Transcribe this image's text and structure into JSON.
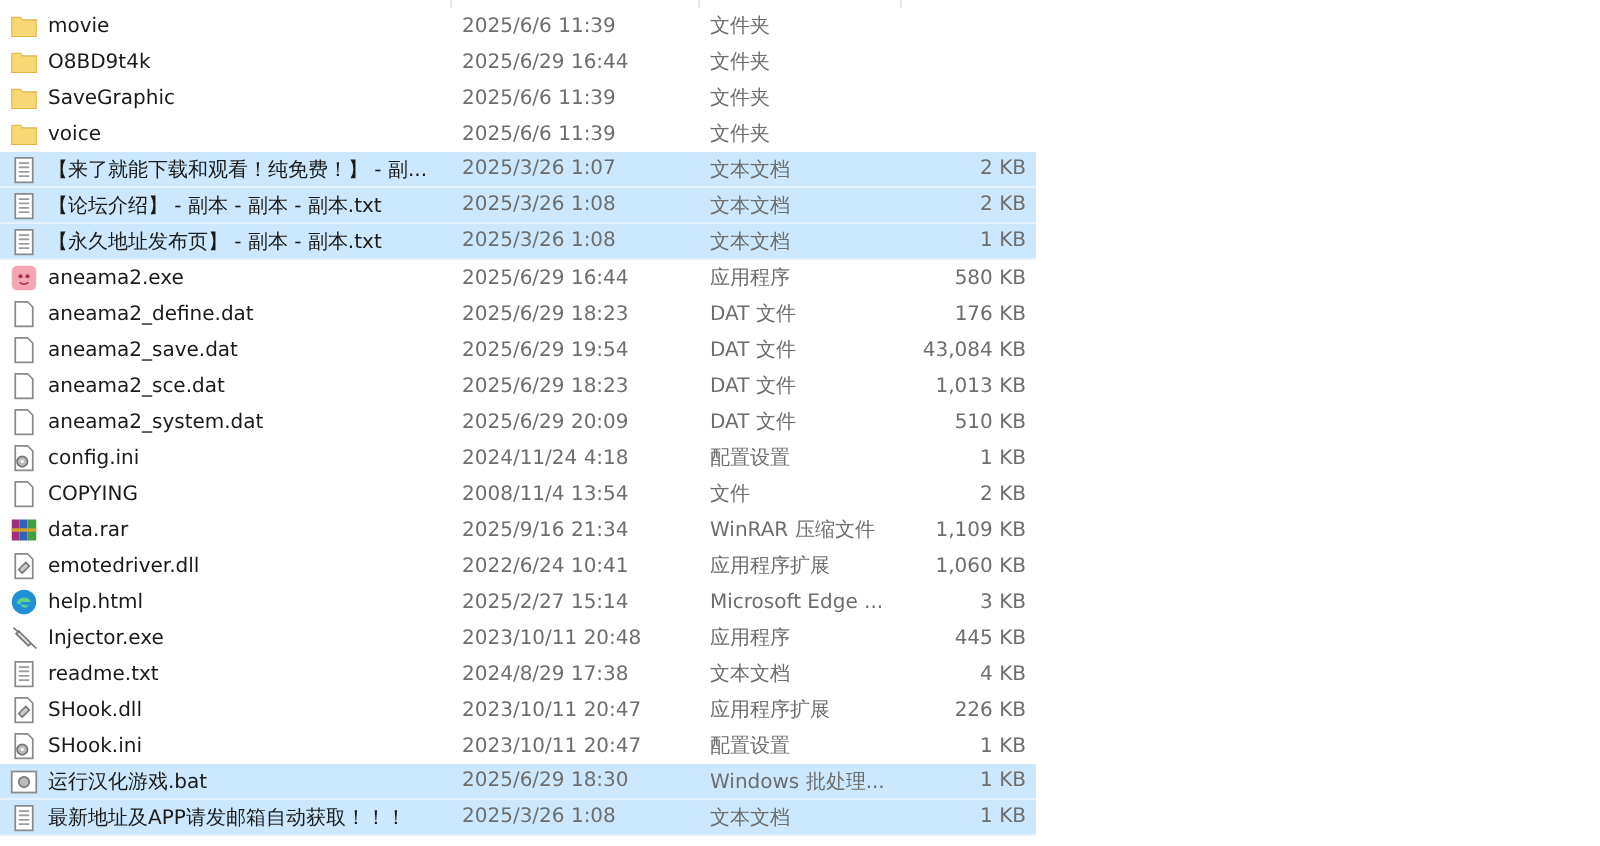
{
  "files": [
    {
      "kind": "folder",
      "name": "movie",
      "modified": "2025/6/6 11:39",
      "type": "文件夹",
      "selected": false
    },
    {
      "kind": "folder",
      "name": "O8BD9t4k",
      "modified": "2025/6/29 16:44",
      "type": "文件夹",
      "selected": false
    },
    {
      "kind": "folder",
      "name": "SaveGraphic",
      "modified": "2025/6/6 11:39",
      "type": "文件夹",
      "selected": false
    },
    {
      "kind": "folder",
      "name": "voice",
      "modified": "2025/6/6 11:39",
      "type": "文件夹",
      "selected": false
    },
    {
      "kind": "text",
      "name": "【来了就能下载和观看！纯免费！】 - 副...",
      "modified": "2025/3/26 1:07",
      "type": "文本文档",
      "size": "2 KB",
      "selected": true
    },
    {
      "kind": "text",
      "name": "【论坛介绍】 - 副本 - 副本 - 副本.txt",
      "modified": "2025/3/26 1:08",
      "type": "文本文档",
      "size": "2 KB",
      "selected": true
    },
    {
      "kind": "text",
      "name": "【永久地址发布页】 - 副本 - 副本.txt",
      "modified": "2025/3/26 1:08",
      "type": "文本文档",
      "size": "1 KB",
      "selected": true
    },
    {
      "kind": "app",
      "name": "aneama2.exe",
      "modified": "2025/6/29 16:44",
      "type": "应用程序",
      "size": "580 KB",
      "selected": false
    },
    {
      "kind": "blank",
      "name": "aneama2_define.dat",
      "modified": "2025/6/29 18:23",
      "type": "DAT 文件",
      "size": "176 KB",
      "selected": false
    },
    {
      "kind": "blank",
      "name": "aneama2_save.dat",
      "modified": "2025/6/29 19:54",
      "type": "DAT 文件",
      "size": "43,084 KB",
      "selected": false
    },
    {
      "kind": "blank",
      "name": "aneama2_sce.dat",
      "modified": "2025/6/29 18:23",
      "type": "DAT 文件",
      "size": "1,013 KB",
      "selected": false
    },
    {
      "kind": "blank",
      "name": "aneama2_system.dat",
      "modified": "2025/6/29 20:09",
      "type": "DAT 文件",
      "size": "510 KB",
      "selected": false
    },
    {
      "kind": "config",
      "name": "config.ini",
      "modified": "2024/11/24 4:18",
      "type": "配置设置",
      "size": "1 KB",
      "selected": false
    },
    {
      "kind": "blank",
      "name": "COPYING",
      "modified": "2008/11/4 13:54",
      "type": "文件",
      "size": "2 KB",
      "selected": false
    },
    {
      "kind": "archive",
      "name": "data.rar",
      "modified": "2025/9/16 21:34",
      "type": "WinRAR 压缩文件",
      "size": "1,109 KB",
      "selected": false
    },
    {
      "kind": "library",
      "name": "emotedriver.dll",
      "modified": "2022/6/24 10:41",
      "type": "应用程序扩展",
      "size": "1,060 KB",
      "selected": false
    },
    {
      "kind": "web",
      "name": "help.html",
      "modified": "2025/2/27 15:14",
      "type": "Microsoft Edge ...",
      "size": "3 KB",
      "selected": false
    },
    {
      "kind": "tool",
      "name": "Injector.exe",
      "modified": "2023/10/11 20:48",
      "type": "应用程序",
      "size": "445 KB",
      "selected": false
    },
    {
      "kind": "text",
      "name": "readme.txt",
      "modified": "2024/8/29 17:38",
      "type": "文本文档",
      "size": "4 KB",
      "selected": false
    },
    {
      "kind": "library",
      "name": "SHook.dll",
      "modified": "2023/10/11 20:47",
      "type": "应用程序扩展",
      "size": "226 KB",
      "selected": false
    },
    {
      "kind": "config",
      "name": "SHook.ini",
      "modified": "2023/10/11 20:47",
      "type": "配置设置",
      "size": "1 KB",
      "selected": false
    },
    {
      "kind": "batch",
      "name": "运行汉化游戏.bat",
      "modified": "2025/6/29 18:30",
      "type": "Windows 批处理...",
      "size": "1 KB",
      "selected": true
    },
    {
      "kind": "text",
      "name": "最新地址及APP请发邮箱自动获取！！！",
      "modified": "2025/3/26 1:08",
      "type": "文本文档",
      "size": "1 KB",
      "selected": true
    }
  ]
}
